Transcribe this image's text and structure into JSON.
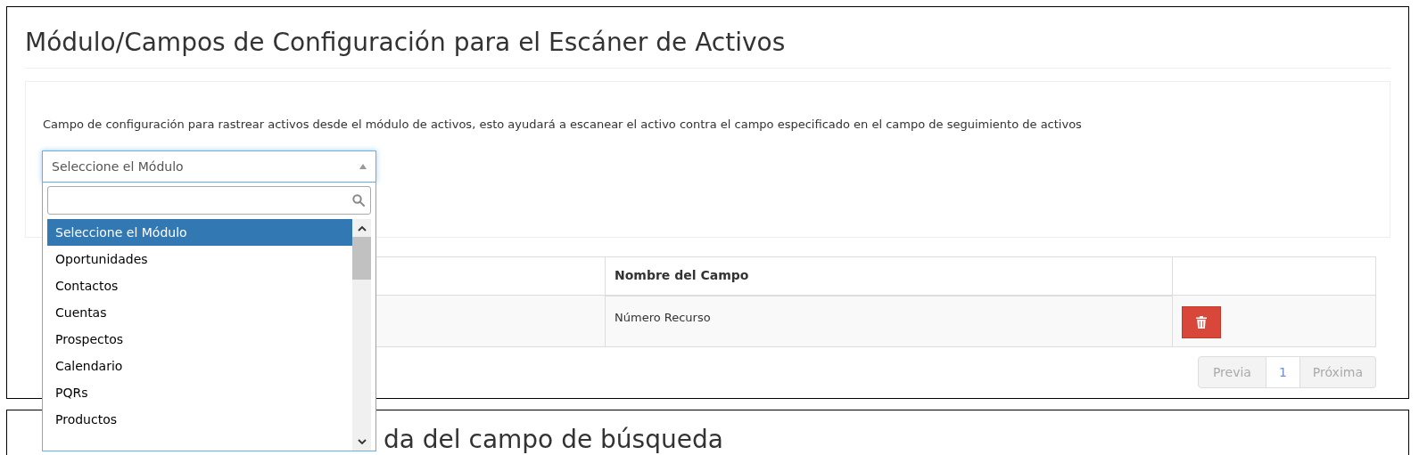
{
  "panel": {
    "title": "Módulo/Campos de Configuración para el Escáner de Activos",
    "description": "Campo de configuración para rastrear activos desde el módulo de activos, esto ayudará a escanear el activo contra el campo especificado en el campo de seguimiento de activos",
    "module_select": {
      "value": "Seleccione el Módulo",
      "expanded": true,
      "options": [
        {
          "label": "Seleccione el Módulo",
          "selected": true
        },
        {
          "label": "Oportunidades",
          "selected": false
        },
        {
          "label": "Contactos",
          "selected": false
        },
        {
          "label": "Cuentas",
          "selected": false
        },
        {
          "label": "Prospectos",
          "selected": false
        },
        {
          "label": "Calendario",
          "selected": false
        },
        {
          "label": "PQRs",
          "selected": false
        },
        {
          "label": "Productos",
          "selected": false
        }
      ]
    },
    "table": {
      "columns": [
        "Nombre del Campo"
      ],
      "rows": [
        {
          "field_name": "Número Recurso"
        }
      ]
    },
    "pagination": {
      "previous": "Previa",
      "pages": [
        {
          "label": "1",
          "selected": true
        }
      ],
      "next": "Próxima",
      "previous_disabled": true,
      "next_disabled": true
    }
  },
  "panel_2": {
    "title": "da del campo de búsqueda"
  }
}
